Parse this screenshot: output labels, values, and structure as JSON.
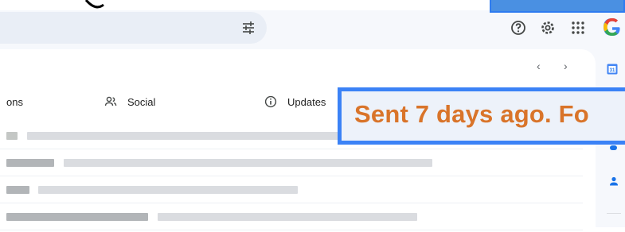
{
  "colors": {
    "accent_blue": "#1a73e8",
    "hint_border": "#3b82f6",
    "hint_text": "#d9742a",
    "search_bg": "#e9eef6",
    "app_bg": "#f6f8fc"
  },
  "header": {
    "icons": [
      "tune-icon",
      "help-icon",
      "settings-icon",
      "apps-icon",
      "google-logo"
    ]
  },
  "pager": {
    "prev": "‹",
    "next": "›"
  },
  "tabs": [
    {
      "label": "ons",
      "icon": "promotions-icon"
    },
    {
      "label": "Social",
      "icon": "people-icon"
    },
    {
      "label": "Updates",
      "icon": "info-icon"
    }
  ],
  "hint": {
    "text": "Sent 7 days ago. Fo"
  },
  "side_panel": {
    "icons": [
      "calendar-icon",
      "keep-icon",
      "contacts-icon"
    ],
    "calendar_day": "31"
  }
}
